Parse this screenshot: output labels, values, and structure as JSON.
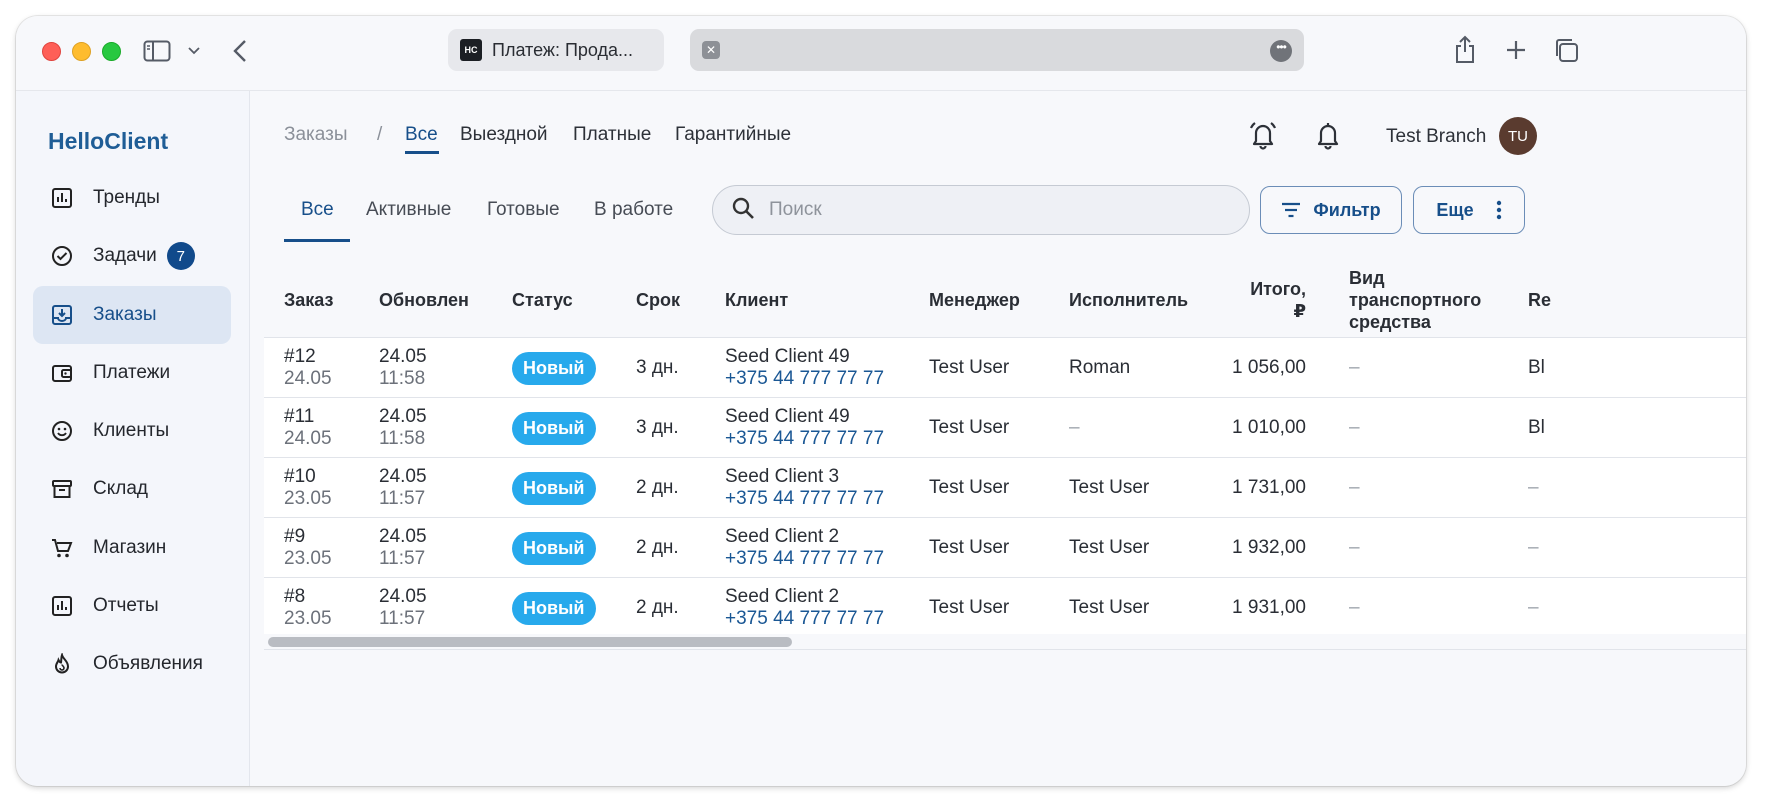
{
  "browser": {
    "tab_active_title": "Платеж: Прода...",
    "tab_active_favicon": "HC",
    "tab_blank_title": ""
  },
  "sidebar": {
    "brand": "HelloClient",
    "items": [
      {
        "label": "Тренды",
        "icon": "chart-icon"
      },
      {
        "label": "Задачи",
        "icon": "check-circle-icon",
        "badge": "7"
      },
      {
        "label": "Заказы",
        "icon": "inbox-icon",
        "active": true
      },
      {
        "label": "Платежи",
        "icon": "wallet-icon"
      },
      {
        "label": "Клиенты",
        "icon": "smile-icon"
      },
      {
        "label": "Склад",
        "icon": "archive-icon"
      },
      {
        "label": "Магазин",
        "icon": "cart-icon"
      },
      {
        "label": "Отчеты",
        "icon": "report-icon"
      },
      {
        "label": "Объявления",
        "icon": "fire-icon"
      }
    ]
  },
  "header": {
    "breadcrumb_root": "Заказы",
    "separator": "/",
    "tabs": [
      "Все",
      "Выездной",
      "Платные",
      "Гарантийные"
    ],
    "branch": "Test Branch",
    "avatar_initials": "TU"
  },
  "toolbar": {
    "tabs": [
      "Все",
      "Активные",
      "Готовые",
      "В работе"
    ],
    "search_placeholder": "Поиск",
    "filter_label": "Фильтр",
    "more_label": "Еще"
  },
  "table": {
    "columns": {
      "order": "Заказ",
      "updated": "Обновлен",
      "status": "Статус",
      "term": "Срок",
      "client": "Клиент",
      "manager": "Менеджер",
      "executor": "Исполнитель",
      "total_line1": "Итого,",
      "total_line2": "₽",
      "vehicle_line1": "Вид",
      "vehicle_line2": "транспортного",
      "vehicle_line3": "средства",
      "extra": "Re"
    },
    "rows": [
      {
        "num": "#12",
        "created": "24.05",
        "upd_date": "24.05",
        "upd_time": "11:58",
        "status": "Новый",
        "term": "3 дн.",
        "client": "Seed Client 49",
        "phone": "+375 44 777 77 77",
        "manager": "Test User",
        "executor": "Roman",
        "total": "1 056,00",
        "vehicle": "–",
        "extra": "Bl"
      },
      {
        "num": "#11",
        "created": "24.05",
        "upd_date": "24.05",
        "upd_time": "11:58",
        "status": "Новый",
        "term": "3 дн.",
        "client": "Seed Client 49",
        "phone": "+375 44 777 77 77",
        "manager": "Test User",
        "executor": "–",
        "total": "1 010,00",
        "vehicle": "–",
        "extra": "Bl"
      },
      {
        "num": "#10",
        "created": "23.05",
        "upd_date": "24.05",
        "upd_time": "11:57",
        "status": "Новый",
        "term": "2 дн.",
        "client": "Seed Client 3",
        "phone": "+375 44 777 77 77",
        "manager": "Test User",
        "executor": "Test User",
        "total": "1 731,00",
        "vehicle": "–",
        "extra": "–"
      },
      {
        "num": "#9",
        "created": "23.05",
        "upd_date": "24.05",
        "upd_time": "11:57",
        "status": "Новый",
        "term": "2 дн.",
        "client": "Seed Client 2",
        "phone": "+375 44 777 77 77",
        "manager": "Test User",
        "executor": "Test User",
        "total": "1 932,00",
        "vehicle": "–",
        "extra": "–"
      },
      {
        "num": "#8",
        "created": "23.05",
        "upd_date": "24.05",
        "upd_time": "11:57",
        "status": "Новый",
        "term": "2 дн.",
        "client": "Seed Client 2",
        "phone": "+375 44 777 77 77",
        "manager": "Test User",
        "executor": "Test User",
        "total": "1 931,00",
        "vehicle": "–",
        "extra": "–"
      }
    ]
  },
  "colors": {
    "accent": "#174f8a",
    "status_new": "#27a9ec",
    "brand": "#1f5d96"
  }
}
